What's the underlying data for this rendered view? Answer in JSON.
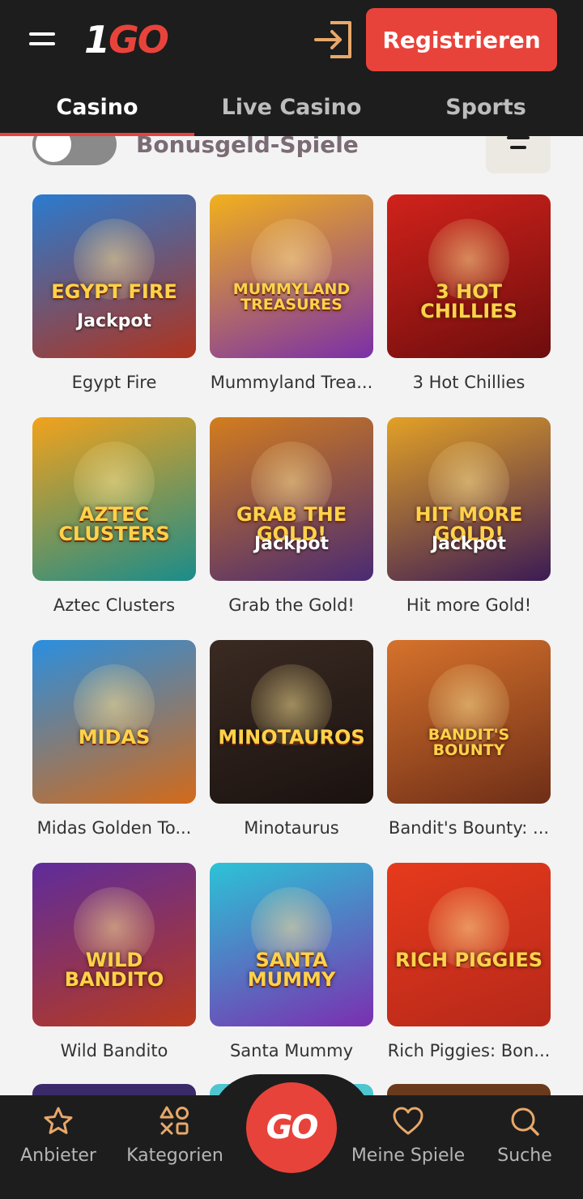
{
  "header": {
    "logo_one": "1",
    "logo_go": "GO",
    "register_label": "Registrieren"
  },
  "tabs": [
    {
      "label": "Casino",
      "active": true
    },
    {
      "label": "Live Casino",
      "active": false
    },
    {
      "label": "Sports",
      "active": false
    }
  ],
  "filter": {
    "toggle_label": "Bonusgeld-Spiele",
    "toggle_on": false
  },
  "games": [
    {
      "name": "Egypt Fire",
      "art": "EGYPT FIRE",
      "badge": "Jackpot",
      "bg": [
        "#2a7bd0",
        "#b0331d"
      ]
    },
    {
      "name": "Mummyland Trea...",
      "art": "MUMMYLAND TREASURES",
      "badge": "",
      "bg": [
        "#f2b11c",
        "#7a2fa8"
      ]
    },
    {
      "name": "3 Hot Chillies",
      "art": "3 HOT CHILLIES",
      "badge": "",
      "bg": [
        "#d1221b",
        "#6d0d0d"
      ]
    },
    {
      "name": "Aztec Clusters",
      "art": "AZTEC CLUSTERS",
      "badge": "",
      "bg": [
        "#f2a21c",
        "#1a8c8a"
      ]
    },
    {
      "name": "Grab the Gold!",
      "art": "GRAB THE GOLD!",
      "badge": "Jackpot",
      "bg": [
        "#d37d1e",
        "#4a2a73"
      ]
    },
    {
      "name": "Hit more Gold!",
      "art": "HIT MORE GOLD!",
      "badge": "Jackpot",
      "bg": [
        "#e3a126",
        "#3b1b55"
      ]
    },
    {
      "name": "Midas Golden To...",
      "art": "MIDAS",
      "badge": "",
      "bg": [
        "#2a8fe0",
        "#d36a19"
      ]
    },
    {
      "name": "Minotaurus",
      "art": "MINOTAUROS",
      "badge": "",
      "bg": [
        "#3a2a22",
        "#1a1210"
      ]
    },
    {
      "name": "Bandit's Bounty: ...",
      "art": "BANDIT'S BOUNTY",
      "badge": "",
      "bg": [
        "#d6722c",
        "#6e2e17"
      ]
    },
    {
      "name": "Wild Bandito",
      "art": "WILD BANDITO",
      "badge": "",
      "bg": [
        "#5e2c9c",
        "#ba3a1c"
      ]
    },
    {
      "name": "Santa Mummy",
      "art": "SANTA MUMMY",
      "badge": "",
      "bg": [
        "#2cc3d6",
        "#7b2fb0"
      ]
    },
    {
      "name": "Rich Piggies: Bon...",
      "art": "RICH PIGGIES",
      "badge": "",
      "bg": [
        "#e63a1c",
        "#b6281a"
      ]
    }
  ],
  "bottom_nav": {
    "providers": "Anbieter",
    "categories": "Kategorien",
    "go": "GO",
    "my_games": "Meine Spiele",
    "search": "Suche"
  },
  "colors": {
    "accent": "#e8433a",
    "dark": "#1d1d1d",
    "background": "#f3f3f3"
  }
}
